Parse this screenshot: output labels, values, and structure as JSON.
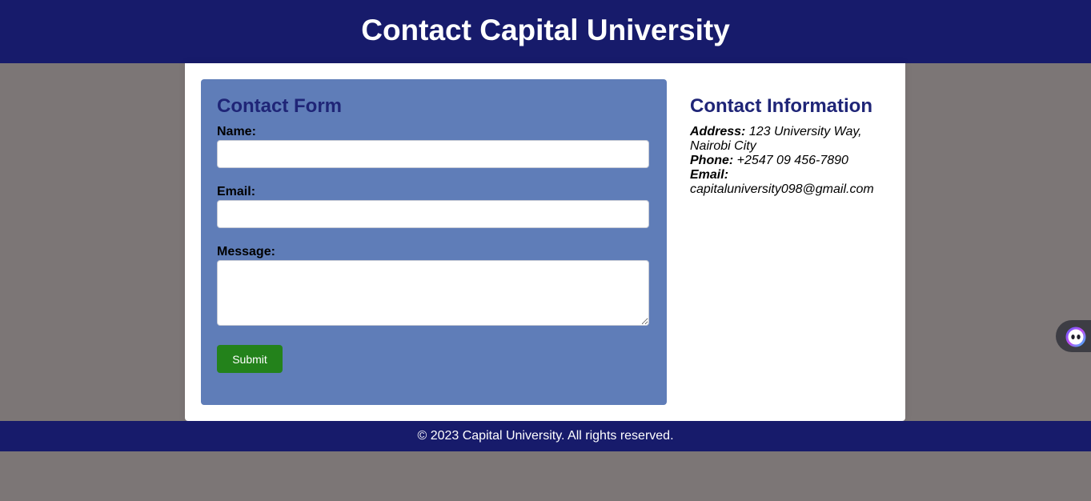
{
  "header": {
    "title": "Contact Capital University"
  },
  "form": {
    "title": "Contact Form",
    "fields": [
      {
        "label": "Name:",
        "value": ""
      },
      {
        "label": "Email:",
        "value": ""
      },
      {
        "label": "Message:",
        "value": ""
      }
    ],
    "submit_label": "Submit"
  },
  "contact_info": {
    "title": "Contact Information",
    "address_label": "Address:",
    "address_value": "123 University Way, Nairobi City",
    "phone_label": "Phone:",
    "phone_value": "+2547 09 456-7890",
    "email_label": "Email:",
    "email_value": "capitaluniversity098@gmail.com"
  },
  "footer": {
    "text": "© 2023 Capital University. All rights reserved."
  },
  "widget": {
    "icon": "assistant-face-icon"
  },
  "colors": {
    "header_bg": "#171b6b",
    "form_panel_bg": "#5f7db8",
    "title_color": "#1f2577",
    "submit_bg": "#23821b",
    "page_bg": "#7c7676"
  }
}
